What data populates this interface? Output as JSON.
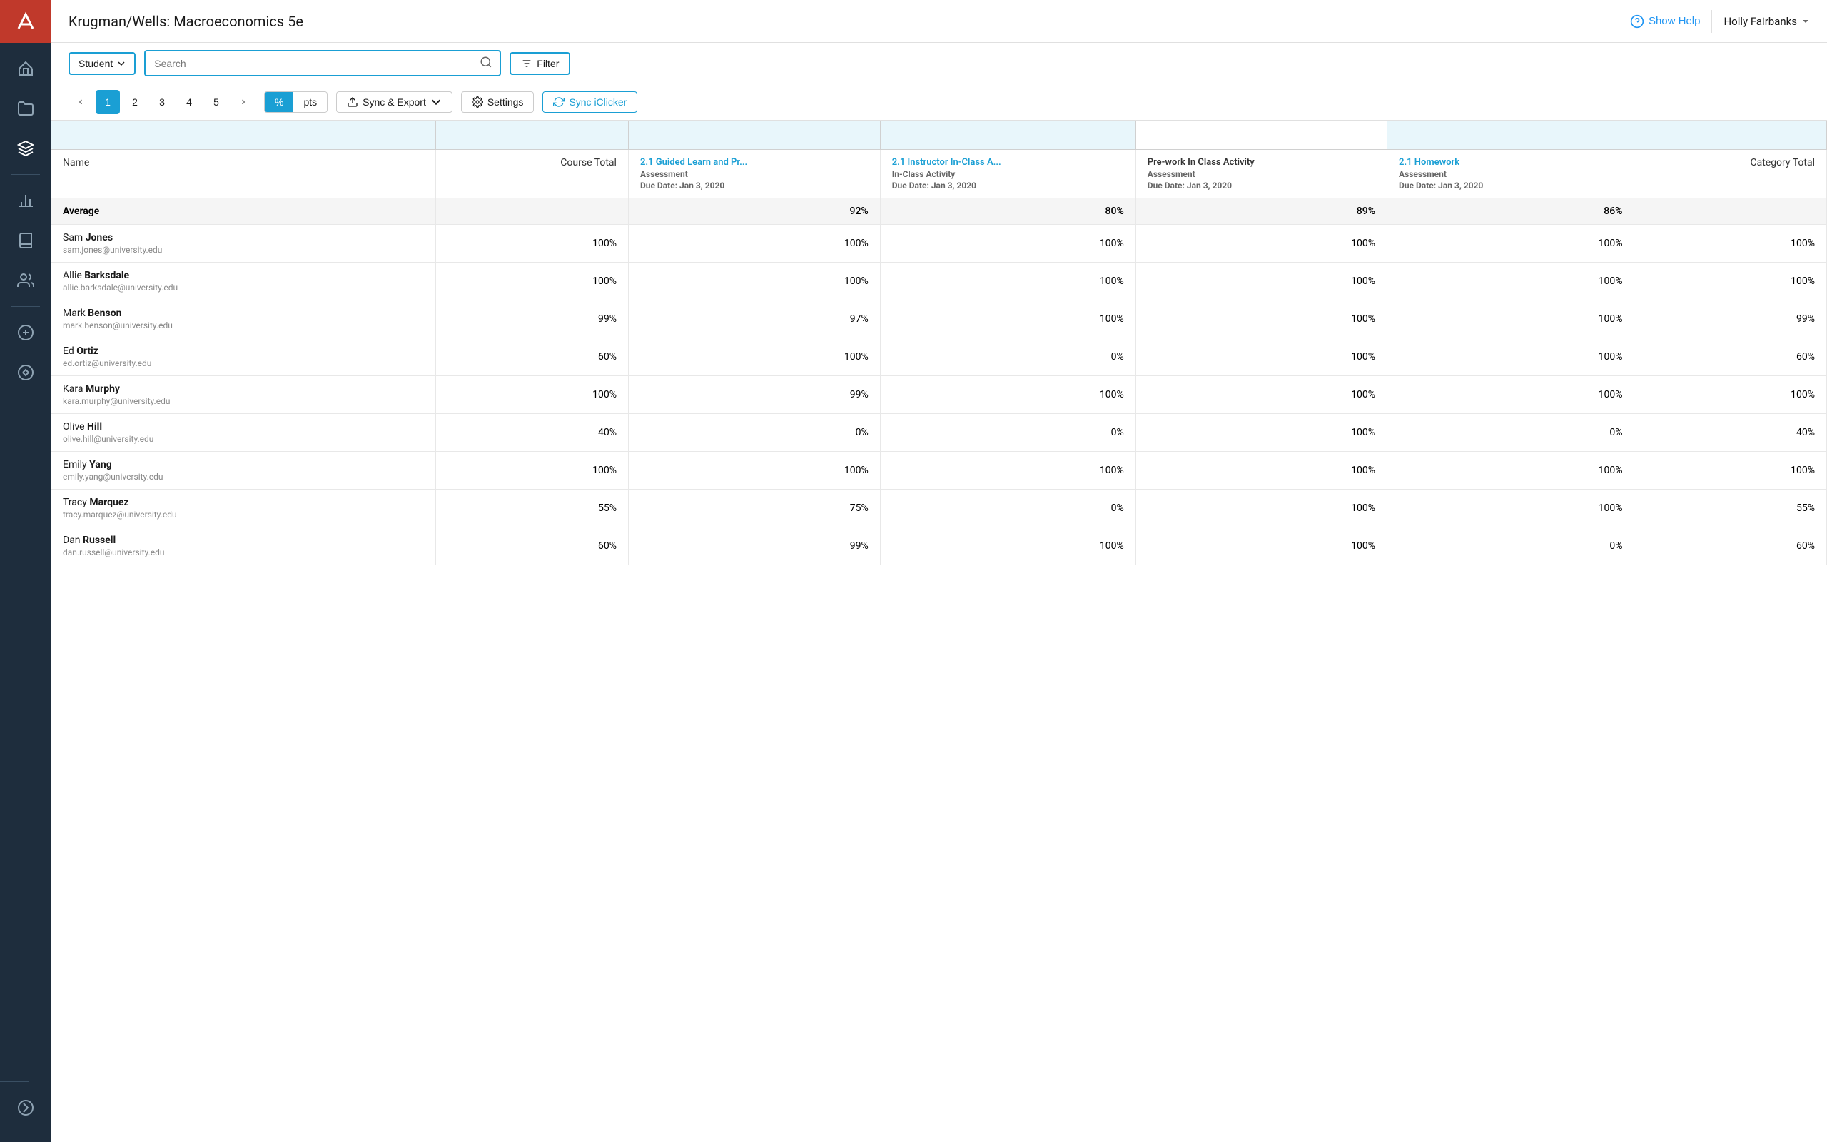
{
  "app": {
    "title": "Krugman/Wells: Macroeconomics 5e",
    "show_help_label": "Show Help",
    "user_name": "Holly Fairbanks"
  },
  "toolbar": {
    "student_label": "Student",
    "search_placeholder": "Search",
    "filter_label": "Filter"
  },
  "pagination": {
    "pages": [
      "1",
      "2",
      "3",
      "4",
      "5"
    ],
    "active_page": 0
  },
  "score_toggle": {
    "percent_label": "%",
    "pts_label": "pts",
    "active": "percent"
  },
  "actions": {
    "sync_export_label": "Sync & Export",
    "settings_label": "Settings",
    "sync_iclicker_label": "Sync iClicker"
  },
  "table": {
    "col_name": "Name",
    "col_course_total": "Course Total",
    "col_category_total": "Category Total",
    "columns": [
      {
        "title": "2.1 Guided Learn and Pr...",
        "subtitle": "Assessment",
        "due_date": "Due Date: Jan 3, 2020",
        "title_color": "#1a9fd4"
      },
      {
        "title": "2.1 Instructor In-Class A...",
        "subtitle": "In-Class Activity",
        "due_date": "Due Date: Jan 3, 2020",
        "title_color": "#1a9fd4"
      },
      {
        "title": "Pre-work In Class Activity",
        "subtitle": "Assessment",
        "due_date": "Due Date: Jan 3, 2020",
        "title_color": "#333"
      },
      {
        "title": "2.1 Homework",
        "subtitle": "Assessment",
        "due_date": "Due Date: Jan 3, 2020",
        "title_color": "#1a9fd4"
      }
    ],
    "average_row": {
      "label": "Average",
      "course_total": "",
      "scores": [
        "92%",
        "80%",
        "89%",
        "86%"
      ],
      "category_total": ""
    },
    "students": [
      {
        "first_name": "Sam",
        "last_name": "Jones",
        "email": "sam.jones@university.edu",
        "course_total": "100%",
        "scores": [
          "100%",
          "100%",
          "100%",
          "100%"
        ],
        "category_total": "100%"
      },
      {
        "first_name": "Allie",
        "last_name": "Barksdale",
        "email": "allie.barksdale@university.edu",
        "course_total": "100%",
        "scores": [
          "100%",
          "100%",
          "100%",
          "100%"
        ],
        "category_total": "100%"
      },
      {
        "first_name": "Mark",
        "last_name": "Benson",
        "email": "mark.benson@university.edu",
        "course_total": "99%",
        "scores": [
          "97%",
          "100%",
          "100%",
          "100%"
        ],
        "category_total": "99%"
      },
      {
        "first_name": "Ed",
        "last_name": "Ortiz",
        "email": "ed.ortiz@university.edu",
        "course_total": "60%",
        "scores": [
          "100%",
          "0%",
          "100%",
          "100%"
        ],
        "category_total": "60%"
      },
      {
        "first_name": "Kara",
        "last_name": "Murphy",
        "email": "kara.murphy@university.edu",
        "course_total": "100%",
        "scores": [
          "99%",
          "100%",
          "100%",
          "100%"
        ],
        "category_total": "100%"
      },
      {
        "first_name": "Olive",
        "last_name": "Hill",
        "email": "olive.hill@university.edu",
        "course_total": "40%",
        "scores": [
          "0%",
          "0%",
          "100%",
          "0%"
        ],
        "category_total": "40%"
      },
      {
        "first_name": "Emily",
        "last_name": "Yang",
        "email": "emily.yang@university.edu",
        "course_total": "100%",
        "scores": [
          "100%",
          "100%",
          "100%",
          "100%"
        ],
        "category_total": "100%"
      },
      {
        "first_name": "Tracy",
        "last_name": "Marquez",
        "email": "tracy.marquez@university.edu",
        "course_total": "55%",
        "scores": [
          "75%",
          "0%",
          "100%",
          "100%"
        ],
        "category_total": "55%"
      },
      {
        "first_name": "Dan",
        "last_name": "Russell",
        "email": "dan.russell@university.edu",
        "course_total": "60%",
        "scores": [
          "99%",
          "100%",
          "100%",
          "0%"
        ],
        "category_total": "60%"
      }
    ]
  },
  "sidebar": {
    "items": [
      {
        "name": "home",
        "icon": "home"
      },
      {
        "name": "folder",
        "icon": "folder"
      },
      {
        "name": "layers",
        "icon": "layers"
      },
      {
        "name": "chart",
        "icon": "chart"
      },
      {
        "name": "notebook",
        "icon": "notebook"
      },
      {
        "name": "users",
        "icon": "users"
      }
    ],
    "bottom_items": [
      {
        "name": "add",
        "icon": "add"
      },
      {
        "name": "transfer",
        "icon": "transfer"
      },
      {
        "name": "expand",
        "icon": "expand"
      }
    ]
  }
}
